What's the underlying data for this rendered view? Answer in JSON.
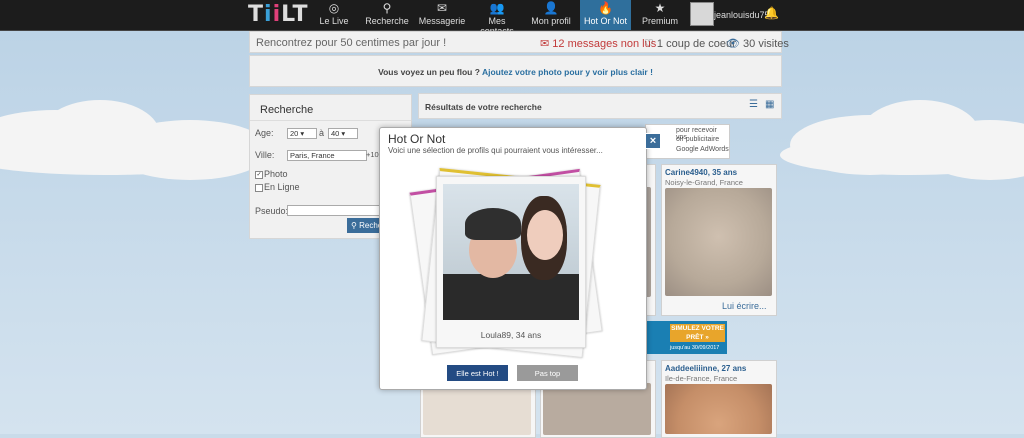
{
  "brand": {
    "logo": "TiiLT"
  },
  "nav": [
    {
      "label": "Le Live",
      "icon": "target-icon",
      "glyph": "◎"
    },
    {
      "label": "Recherche",
      "icon": "search-icon",
      "glyph": "⚲"
    },
    {
      "label": "Messagerie",
      "icon": "envelope-icon",
      "glyph": "✉"
    },
    {
      "label": "Mes contacts",
      "icon": "contacts-icon",
      "glyph": "👥"
    },
    {
      "label": "Mon profil",
      "icon": "user-icon",
      "glyph": "👤"
    },
    {
      "label": "Hot Or Not",
      "icon": "flame-icon",
      "glyph": "🔥"
    },
    {
      "label": "Premium",
      "icon": "star-icon",
      "glyph": "★"
    }
  ],
  "user": {
    "name": "jeanlouisdu75"
  },
  "infobar": {
    "promo": "Rencontrez pour 50 centimes par jour !",
    "messages": "12 messages non lus",
    "likes": "1 coup de coeur",
    "visits": "30 visites"
  },
  "promo": {
    "text": "Vous voyez un peu flou ?",
    "link": "Ajoutez votre photo pour y voir plus clair !"
  },
  "search": {
    "title": "Recherche",
    "age_label": "Age:",
    "age_from": "20",
    "age_to_label": "à",
    "age_to": "40",
    "city_label": "Ville:",
    "city_value": "Paris, France",
    "radius": "+10",
    "photo_label": "Photo",
    "online_label": "En Ligne",
    "pseudo_label": "Pseudo:",
    "search_button": "Rechercher"
  },
  "results": {
    "title": "Résultats de votre recherche"
  },
  "profiles": [
    {
      "name": "Carine4940, 35 ans",
      "location": "Noisy-le-Grand, France",
      "cta": "Lui écrire..."
    },
    {
      "name": "Aaddeeliiinne, 27 ans",
      "location": "Ile-de-France, France"
    }
  ],
  "ads": {
    "google": "pour recevoir vos",
    "google2": "oir publicitaire",
    "google3": "Google AdWords",
    "loan": "SIMULEZ VOTRE PRÊT »",
    "loan_date": "jusqu'au 30/09/2017"
  },
  "modal": {
    "title": "Hot Or Not",
    "subtitle": "Voici une sélection de profils qui pourraient vous intéresser...",
    "caption": "Loula89, 34 ans",
    "hot_button": "Elle est Hot !",
    "not_button": "Pas top",
    "close": "×"
  },
  "colors": {
    "accent": "#3b6d9a",
    "hot": "#234b83",
    "alert": "#d13b3b",
    "link": "#2a6fa0"
  }
}
